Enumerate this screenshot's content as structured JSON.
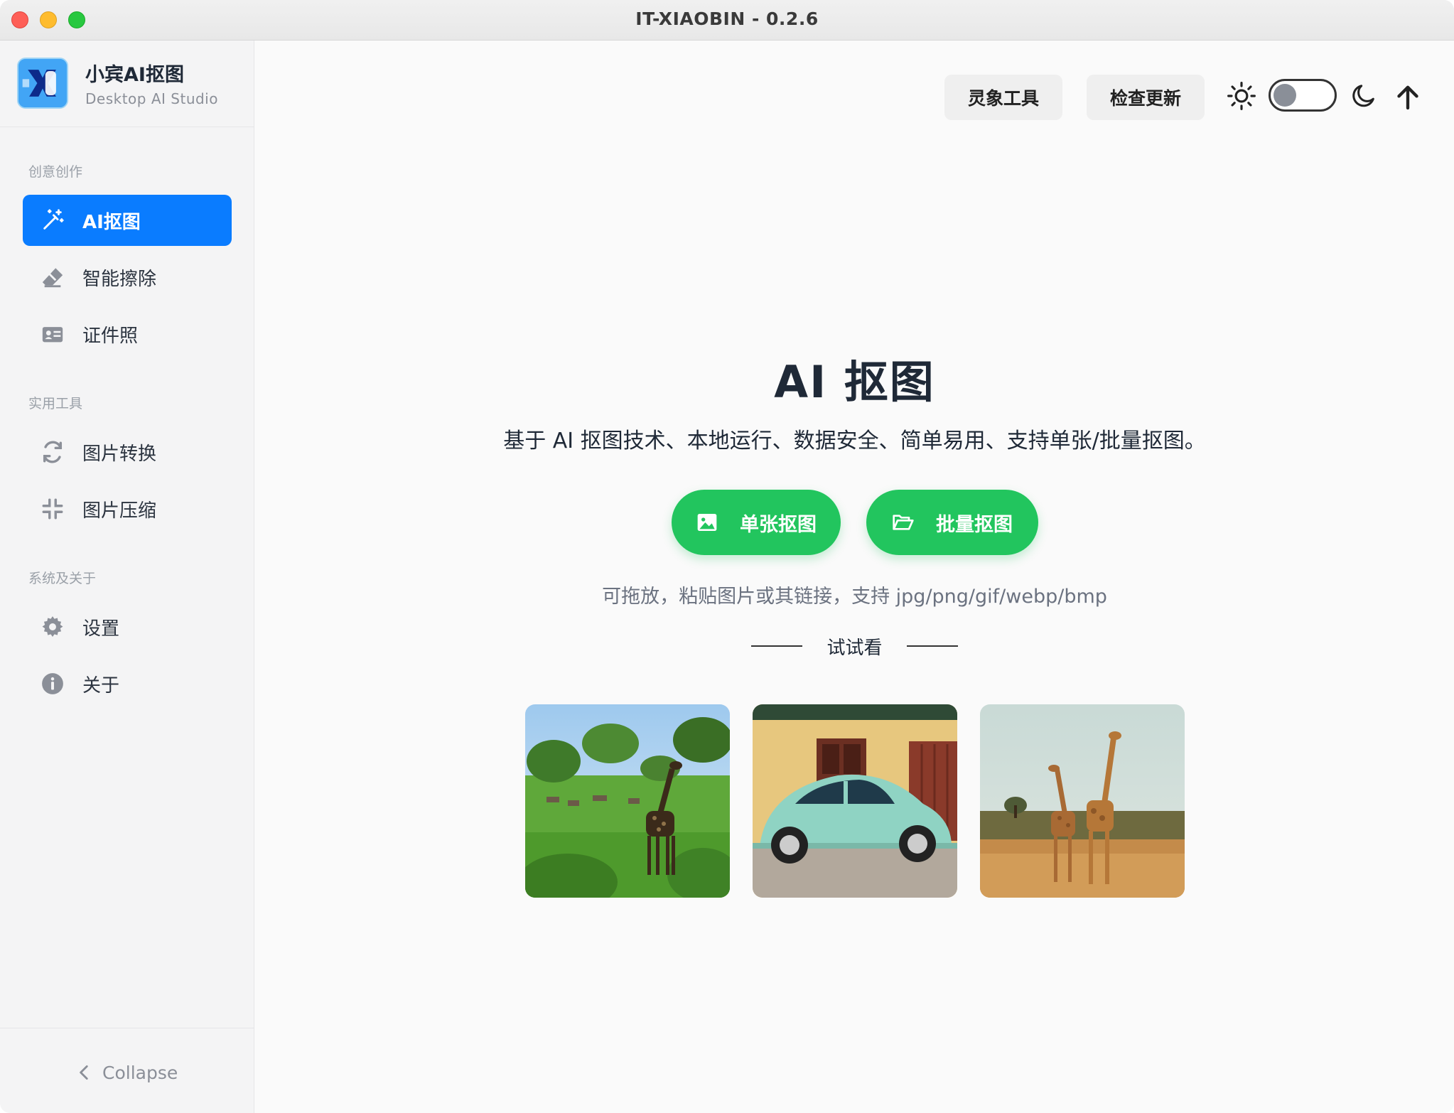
{
  "window": {
    "title": "IT-XIAOBIN - 0.2.6"
  },
  "brand": {
    "name": "小宾AI抠图",
    "subtitle": "Desktop AI Studio"
  },
  "sidebar": {
    "sections": [
      {
        "label": "创意创作"
      },
      {
        "label": "实用工具"
      },
      {
        "label": "系统及关于"
      }
    ],
    "items": [
      {
        "label": "AI抠图",
        "icon": "magic-wand-icon",
        "active": true
      },
      {
        "label": "智能擦除",
        "icon": "eraser-icon"
      },
      {
        "label": "证件照",
        "icon": "id-card-icon"
      },
      {
        "label": "图片转换",
        "icon": "refresh-icon"
      },
      {
        "label": "图片压缩",
        "icon": "compress-icon"
      },
      {
        "label": "设置",
        "icon": "gear-icon"
      },
      {
        "label": "关于",
        "icon": "info-icon"
      }
    ],
    "collapse_label": "Collapse"
  },
  "toolbar": {
    "lingxiang_label": "灵象工具",
    "check_update_label": "检查更新",
    "theme": "light"
  },
  "hero": {
    "title": "AI 抠图",
    "description": "基于 AI 抠图技术、本地运行、数据安全、简单易用、支持单张/批量抠图。",
    "single_label": "单张抠图",
    "batch_label": "批量抠图",
    "hint": "可拖放，粘贴图片或其链接，支持 jpg/png/gif/webp/bmp",
    "try_label": "试试看"
  },
  "colors": {
    "accent": "#0a7cff",
    "cta_green": "#22c55e"
  }
}
